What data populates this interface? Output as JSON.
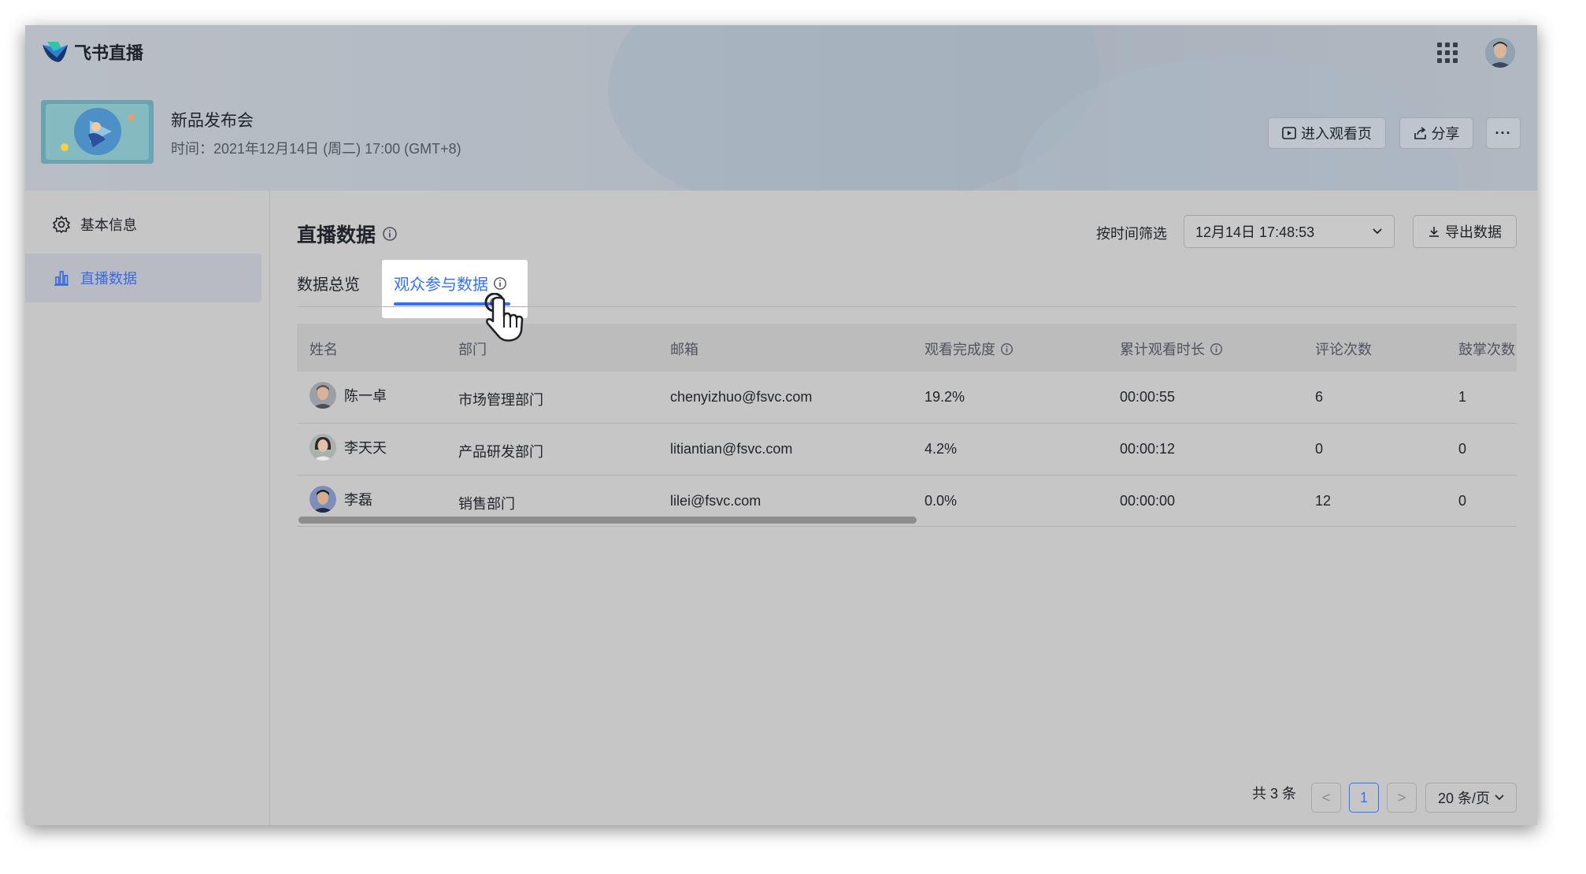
{
  "app": {
    "name": "飞书直播"
  },
  "event": {
    "title": "新品发布会",
    "time": "时间：2021年12月14日 (周二) 17:00 (GMT+8)"
  },
  "header_actions": {
    "enter_watch": "进入观看页",
    "share": "分享",
    "more": "···"
  },
  "sidebar": {
    "items": [
      {
        "label": "基本信息",
        "icon": "gear-icon"
      },
      {
        "label": "直播数据",
        "icon": "bar-chart-icon",
        "active": true
      }
    ]
  },
  "main": {
    "title": "直播数据",
    "filter_label": "按时间筛选",
    "filter_value": "12月14日 17:48:53",
    "export_label": "导出数据",
    "tabs": [
      {
        "label": "数据总览"
      },
      {
        "label": "观众参与数据",
        "active": true
      }
    ]
  },
  "table": {
    "headers": [
      "姓名",
      "部门",
      "邮箱",
      "观看完成度",
      "累计观看时长",
      "评论次数",
      "鼓掌次数"
    ],
    "rows": [
      {
        "name": "陈一卓",
        "dept": "市场管理部门",
        "email": "chenyizhuo@fsvc.com",
        "completion": "19.2%",
        "duration": "00:00:55",
        "comments": "6",
        "claps": "1"
      },
      {
        "name": "李天天",
        "dept": "产品研发部门",
        "email": "litiantian@fsvc.com",
        "completion": "4.2%",
        "duration": "00:00:12",
        "comments": "0",
        "claps": "0"
      },
      {
        "name": "李磊",
        "dept": "销售部门",
        "email": "lilei@fsvc.com",
        "completion": "0.0%",
        "duration": "00:00:00",
        "comments": "12",
        "claps": "0"
      }
    ]
  },
  "pagination": {
    "total": "共 3 条",
    "current": "1",
    "prev": "<",
    "next": ">",
    "page_size": "20 条/页"
  },
  "colors": {
    "accent": "#3370ff",
    "text": "#1f2329"
  }
}
